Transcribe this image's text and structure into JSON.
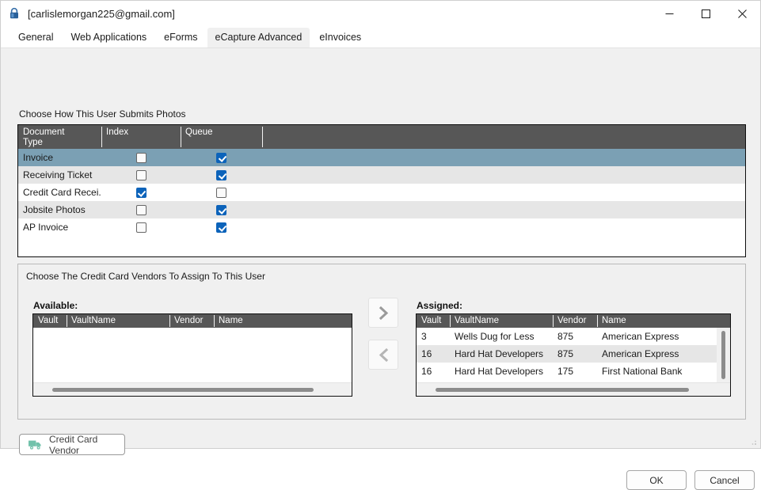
{
  "window": {
    "title": "[carlislemorgan225@gmail.com]",
    "lock_icon": "lock-icon",
    "controls": {
      "minimize": "minimize-icon",
      "maximize": "maximize-icon",
      "close": "close-icon"
    }
  },
  "tabs": [
    {
      "label": "General",
      "active": false
    },
    {
      "label": "Web Applications",
      "active": false
    },
    {
      "label": "eForms",
      "active": false
    },
    {
      "label": "eCapture Advanced",
      "active": true
    },
    {
      "label": "eInvoices",
      "active": false
    }
  ],
  "photos_group": {
    "label": "Choose How This User Submits Photos",
    "columns": [
      "Document Type",
      "Index",
      "Queue",
      ""
    ],
    "column_doc_line1": "Document",
    "column_doc_line2": "Type",
    "rows": [
      {
        "document_type": "Invoice",
        "index": false,
        "queue": true,
        "selected": true
      },
      {
        "document_type": "Receiving Ticket",
        "index": false,
        "queue": true,
        "selected": false
      },
      {
        "document_type": "Credit Card Recei...",
        "index": true,
        "queue": false,
        "selected": false
      },
      {
        "document_type": "Jobsite Photos",
        "index": false,
        "queue": true,
        "selected": false
      },
      {
        "document_type": "AP Invoice",
        "index": false,
        "queue": true,
        "selected": false
      }
    ]
  },
  "vendors_group": {
    "label": "Choose The Credit Card Vendors To Assign To This User",
    "available": {
      "title": "Available:",
      "columns": [
        "Vault",
        "VaultName",
        "Vendor",
        "Name"
      ],
      "rows": []
    },
    "assigned": {
      "title": "Assigned:",
      "columns": [
        "Vault",
        "VaultName",
        "Vendor",
        "Name"
      ],
      "rows": [
        {
          "vault": "3",
          "vault_name": "Wells Dug for Less",
          "vendor": "875",
          "name": "American Express"
        },
        {
          "vault": "16",
          "vault_name": "Hard Hat Developers",
          "vendor": "875",
          "name": "American Express"
        },
        {
          "vault": "16",
          "vault_name": "Hard Hat Developers",
          "vendor": "175",
          "name": "First National Bank"
        }
      ]
    },
    "assign_button": "chevron-right-icon",
    "unassign_button": "chevron-left-icon"
  },
  "footer": {
    "credit_card_vendor_label": "Credit Card Vendor",
    "credit_card_vendor_icon": "truck-icon",
    "ok_label": "OK",
    "cancel_label": "Cancel"
  },
  "colors": {
    "selected_row": "#7ba0b4",
    "grid_header": "#575757",
    "checkbox_checked": "#0c63ba",
    "truck_icon": "#71c2ab",
    "lock_icon": "#2a6099"
  }
}
